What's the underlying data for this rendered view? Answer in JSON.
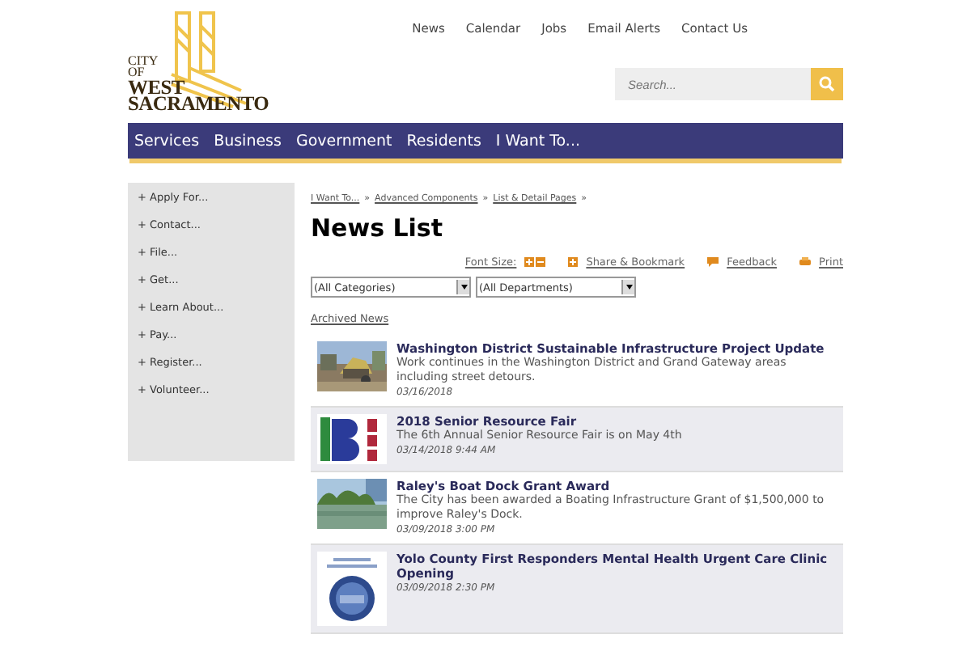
{
  "logo": {
    "lines": [
      "CITY",
      "OF",
      "WEST",
      "SACRAMENTO"
    ]
  },
  "top_links": [
    "News",
    "Calendar",
    "Jobs",
    "Email Alerts",
    "Contact Us"
  ],
  "search": {
    "placeholder": "Search..."
  },
  "nav": [
    "Services",
    "Business",
    "Government",
    "Residents",
    "I Want To..."
  ],
  "sidebar": {
    "items": [
      "+ Apply For...",
      "+ Contact...",
      "+ File...",
      "+ Get...",
      "+ Learn About...",
      "+ Pay...",
      "+ Register...",
      "+ Volunteer..."
    ]
  },
  "breadcrumb": [
    "I Want To...",
    "»",
    "Advanced Components",
    "»",
    "List & Detail Pages",
    "»"
  ],
  "page_title": "News List",
  "tools": {
    "font_size": "Font Size:",
    "share": "Share & Bookmark",
    "feedback": "Feedback",
    "print": "Print"
  },
  "filters": [
    {
      "value": "(All Categories)"
    },
    {
      "value": "(All Departments)"
    }
  ],
  "archived_link": "Archived News",
  "news": [
    {
      "kind": "construction",
      "title": "Washington District Sustainable Infrastructure Project Update",
      "summary": "Work continues in the Washington District and Grand Gateway areas including street detours.",
      "date": "03/16/2018"
    },
    {
      "kind": "logo",
      "title": "2018 Senior Resource Fair",
      "summary": "The 6th Annual Senior Resource Fair is on May 4th",
      "date": "03/14/2018 9:44 AM"
    },
    {
      "kind": "river",
      "title": "Raley's Boat Dock Grant Award",
      "summary": "The City has been awarded a Boating Infrastructure Grant of $1,500,000 to improve Raley's Dock.",
      "date": "03/09/2018 3:00 PM"
    },
    {
      "kind": "seal",
      "title": "Yolo County First Responders Mental Health Urgent Care Clinic Opening",
      "date": "03/09/2018 2:30 PM"
    }
  ]
}
